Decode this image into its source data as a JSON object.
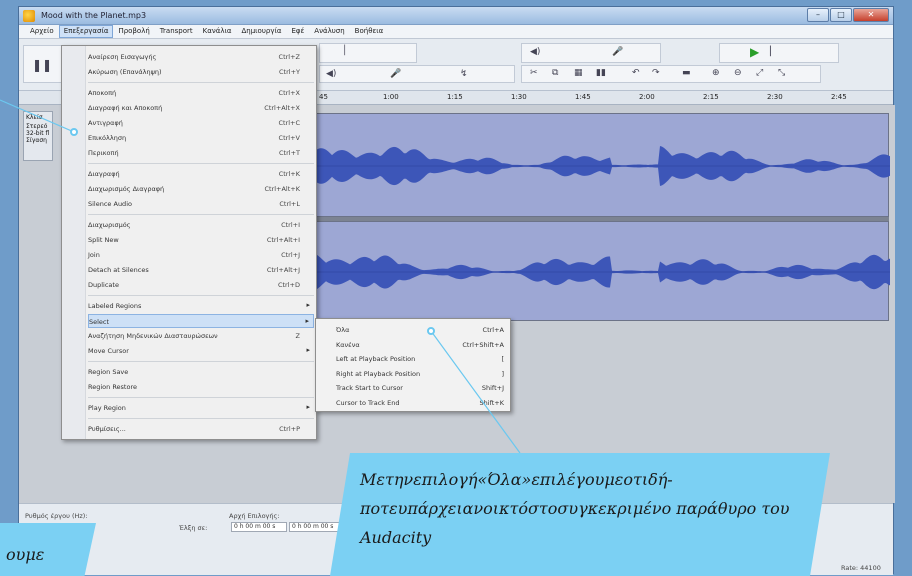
{
  "window": {
    "title": "Mood with the Planet.mp3",
    "buttons": {
      "min": "–",
      "max": "□",
      "close": "✕"
    }
  },
  "menubar": {
    "items": [
      "Αρχείο",
      "Επεξεργασία",
      "Προβολή",
      "Transport",
      "Κανάλια",
      "Δημιουργία",
      "Εφέ",
      "Ανάλυση",
      "Βοήθεια"
    ],
    "active_index": 1
  },
  "timeline": {
    "ticks": [
      "45",
      "1:00",
      "1:15",
      "1:30",
      "1:45",
      "2:00",
      "2:15",
      "2:30",
      "2:45"
    ]
  },
  "track_panel": {
    "label_top": "Κλείσ",
    "label_2": "Στερεό",
    "label_3": "32-bit fl",
    "label_4": "Σίγαση"
  },
  "edit_menu": {
    "items": [
      {
        "label": "Αναίρεση Εισαγωγής",
        "shortcut": "Ctrl+Z"
      },
      {
        "label": "Ακύρωση (Επανάληψη)",
        "shortcut": "Ctrl+Y"
      },
      {
        "sep": true
      },
      {
        "label": "Αποκοπή",
        "shortcut": "Ctrl+X"
      },
      {
        "label": "Διαγραφή και Αποκοπή",
        "shortcut": "Ctrl+Alt+X"
      },
      {
        "label": "Αντιγραφή",
        "shortcut": "Ctrl+C"
      },
      {
        "label": "Επικόλληση",
        "shortcut": "Ctrl+V"
      },
      {
        "label": "Περικοπή",
        "shortcut": "Ctrl+T"
      },
      {
        "sep": true
      },
      {
        "label": "Διαγραφή",
        "shortcut": "Ctrl+K"
      },
      {
        "label": "Διαχωρισμός Διαγραφή",
        "shortcut": "Ctrl+Alt+K"
      },
      {
        "label": "Silence Audio",
        "shortcut": "Ctrl+L"
      },
      {
        "sep": true
      },
      {
        "label": "Διαχωρισμός",
        "shortcut": "Ctrl+I"
      },
      {
        "label": "Split New",
        "shortcut": "Ctrl+Alt+I"
      },
      {
        "label": "Join",
        "shortcut": "Ctrl+J"
      },
      {
        "label": "Detach at Silences",
        "shortcut": "Ctrl+Alt+J"
      },
      {
        "label": "Duplicate",
        "shortcut": "Ctrl+D"
      },
      {
        "sep": true
      },
      {
        "label": "Labeled Regions",
        "shortcut": "",
        "submenu": true
      },
      {
        "label": "Select",
        "shortcut": "",
        "submenu": true,
        "highlight": true
      },
      {
        "label": "Αναζήτηση Μηδενικών Διασταυρώσεων",
        "shortcut": "Z"
      },
      {
        "label": "Move Cursor",
        "shortcut": "",
        "submenu": true
      },
      {
        "sep": true
      },
      {
        "label": "Region Save",
        "shortcut": ""
      },
      {
        "label": "Region Restore",
        "shortcut": ""
      },
      {
        "sep": true
      },
      {
        "label": "Play Region",
        "shortcut": "",
        "submenu": true
      },
      {
        "sep": true
      },
      {
        "label": "Ρυθμίσεις...",
        "shortcut": "Ctrl+P"
      }
    ]
  },
  "select_submenu": {
    "items": [
      {
        "label": "Όλα",
        "shortcut": "Ctrl+A",
        "highlight": true
      },
      {
        "label": "Κανένα",
        "shortcut": "Ctrl+Shift+A"
      },
      {
        "label": "Left at Playback Position",
        "shortcut": "["
      },
      {
        "label": "Right at Playback Position",
        "shortcut": "]"
      },
      {
        "label": "Track Start to Cursor",
        "shortcut": "Shift+J"
      },
      {
        "label": "Cursor to Track End",
        "shortcut": "Shift+K"
      }
    ]
  },
  "bottom_panel": {
    "rate_label": "Ρυθμός έργου (Hz):",
    "sel_start_label": "Αρχή Επιλογής:",
    "snap_label": "Έλξη σε:",
    "field_1": "0 h 00 m 00 s",
    "field_2": "0 h 00 m 00 s",
    "status_right": "Rate: 44100"
  },
  "annotations": {
    "main_text": "Μετηνεπιλογή«Όλα»επιλέγουμεοτιδή-ποτευπάρχειανοικτόστοσυγκεκριμένο παράθυρο του Audacity",
    "left_text": "ουμε"
  },
  "colors": {
    "waveform": "#3d56b8",
    "track_bg": "#9da7d4",
    "callout": "#7bd0f3",
    "menu_highlight": "#cde0f6"
  }
}
